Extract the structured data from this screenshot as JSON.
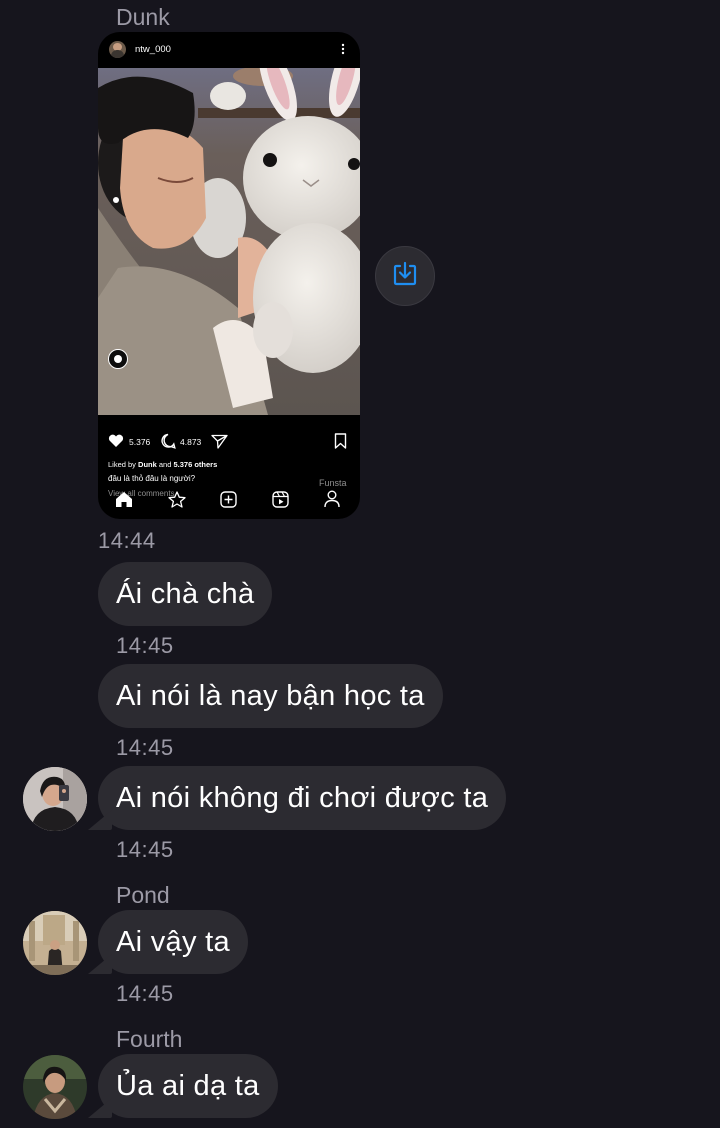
{
  "colors": {
    "background": "#16151d",
    "bubble": "#2c2b31",
    "meta_text": "#9c9aa6",
    "accent_blue": "#1f8ef1"
  },
  "messages": {
    "sender_dunk": "Dunk",
    "shared_post": {
      "username": "ntw_000",
      "likes": "5.376",
      "comments": "4.873",
      "liked_by_prefix": "Liked by ",
      "liked_by_name": "Dunk",
      "liked_by_mid": " and ",
      "liked_by_others": "5.376 others",
      "caption": "đâu là thỏ đâu là người?",
      "view_comments": "View all comments",
      "watermark": "Funsta",
      "icons": [
        "heart-icon",
        "comment-icon",
        "send-icon",
        "bookmark-icon",
        "home-icon",
        "star-icon",
        "add-icon",
        "reels-icon",
        "profile-icon"
      ]
    },
    "time_1": "14:44",
    "msg_1": "Ái chà chà",
    "time_2": "14:45",
    "msg_2": "Ai nói là nay bận học ta",
    "time_3": "14:45",
    "msg_3": "Ai nói không đi chơi được ta",
    "time_4": "14:45",
    "sender_pond": "Pond",
    "msg_4": "Ai vậy ta",
    "time_5": "14:45",
    "sender_fourth": "Fourth",
    "msg_5": "Ủa ai dạ ta"
  }
}
